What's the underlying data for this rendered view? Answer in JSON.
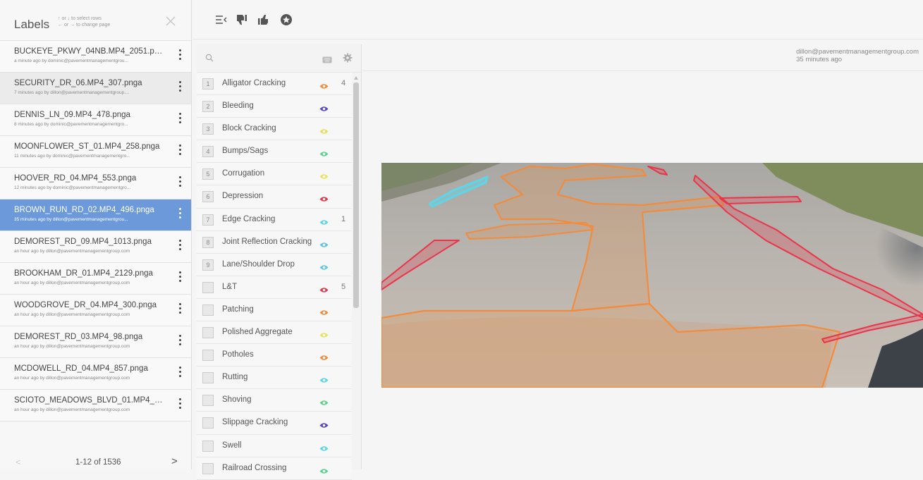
{
  "labels_panel": {
    "title": "Labels",
    "hint_line1": "↑ or ↓ to select rows",
    "hint_line2": "← or → to change page",
    "close_icon": "close-icon"
  },
  "files": [
    {
      "name": "BUCKEYE_PKWY_04NB.MP4_2051.pn...",
      "meta": "a minute ago by dominic@pavementmanagementgrou...",
      "state": "normal"
    },
    {
      "name": "SECURITY_DR_06.MP4_307.pnga",
      "meta": "7 minutes ago by dillon@pavementmanagementgroup....",
      "state": "gray"
    },
    {
      "name": "DENNIS_LN_09.MP4_478.pnga",
      "meta": "8 minutes ago by dominic@pavementmanagementgro...",
      "state": "normal"
    },
    {
      "name": "MOONFLOWER_ST_01.MP4_258.pnga",
      "meta": "11 minutes ago by dominic@pavementmanagementgro...",
      "state": "normal"
    },
    {
      "name": "HOOVER_RD_04.MP4_553.pnga",
      "meta": "12 minutes ago by dominic@pavementmanagementgro...",
      "state": "normal"
    },
    {
      "name": "BROWN_RUN_RD_02.MP4_496.pnga",
      "meta": "35 minutes ago by dillon@pavementmanagementgrou...",
      "state": "selected"
    },
    {
      "name": "DEMOREST_RD_09.MP4_1013.pnga",
      "meta": "an hour ago by dillon@pavementmanagementgroup.com",
      "state": "normal"
    },
    {
      "name": "BROOKHAM_DR_01.MP4_2129.pnga",
      "meta": "an hour ago by dillon@pavementmanagementgroup.com",
      "state": "normal"
    },
    {
      "name": "WOODGROVE_DR_04.MP4_300.pnga",
      "meta": "an hour ago by dillon@pavementmanagementgroup.com",
      "state": "normal"
    },
    {
      "name": "DEMOREST_RD_03.MP4_98.pnga",
      "meta": "an hour ago by dillon@pavementmanagementgroup.com",
      "state": "normal"
    },
    {
      "name": "MCDOWELL_RD_04.MP4_857.pnga",
      "meta": "an hour ago by dillon@pavementmanagementgroup.com",
      "state": "normal"
    },
    {
      "name": "SCIOTO_MEADOWS_BLVD_01.MP4_3...",
      "meta": "an hour ago by dillon@pavementmanagementgroup.com",
      "state": "normal"
    }
  ],
  "pager": {
    "text": "1-12 of 1536",
    "prev": "<",
    "next": ">"
  },
  "toolbar": [
    "align-left-icon",
    "thumbs-down-icon",
    "thumbs-up-icon",
    "star-icon"
  ],
  "classes": [
    {
      "key": "1",
      "name": "Alligator Cracking",
      "color": "#f28c3c",
      "count": "4"
    },
    {
      "key": "2",
      "name": "Bleeding",
      "color": "#5a45c8",
      "count": ""
    },
    {
      "key": "3",
      "name": "Block Cracking",
      "color": "#e8e05a",
      "count": ""
    },
    {
      "key": "4",
      "name": "Bumps/Sags",
      "color": "#5ad48c",
      "count": ""
    },
    {
      "key": "5",
      "name": "Corrugation",
      "color": "#ece15c",
      "count": ""
    },
    {
      "key": "6",
      "name": "Depression",
      "color": "#e8354a",
      "count": ""
    },
    {
      "key": "7",
      "name": "Edge Cracking",
      "color": "#5ed6e8",
      "count": "1"
    },
    {
      "key": "8",
      "name": "Joint Reflection Cracking",
      "color": "#5ec4e8",
      "count": ""
    },
    {
      "key": "9",
      "name": "Lane/Shoulder Drop",
      "color": "#5ec8e8",
      "count": ""
    },
    {
      "key": "",
      "name": "L&T",
      "color": "#e8354a",
      "count": "5"
    },
    {
      "key": "",
      "name": "Patching",
      "color": "#f28c3c",
      "count": ""
    },
    {
      "key": "",
      "name": "Polished Aggregate",
      "color": "#e6e45c",
      "count": ""
    },
    {
      "key": "",
      "name": "Potholes",
      "color": "#f28c3c",
      "count": ""
    },
    {
      "key": "",
      "name": "Rutting",
      "color": "#5ed6e8",
      "count": ""
    },
    {
      "key": "",
      "name": "Shoving",
      "color": "#5ad48c",
      "count": ""
    },
    {
      "key": "",
      "name": "Slippage Cracking",
      "color": "#5a45c8",
      "count": ""
    },
    {
      "key": "",
      "name": "Swell",
      "color": "#5ed6e8",
      "count": ""
    },
    {
      "key": "",
      "name": "Railroad Crossing",
      "color": "#5ad48c",
      "count": ""
    }
  ],
  "class_panel": {
    "search_icon": "search-icon",
    "keyboard_icon": "keyboard-icon",
    "settings_icon": "gear-icon"
  },
  "viewer": {
    "user": "dillon@pavementmanagementgroup.com",
    "time": "35 minutes ago",
    "colors": {
      "alligator": "#f28c3c",
      "lt": "#e8354a",
      "edge": "#5ed6e8"
    }
  }
}
